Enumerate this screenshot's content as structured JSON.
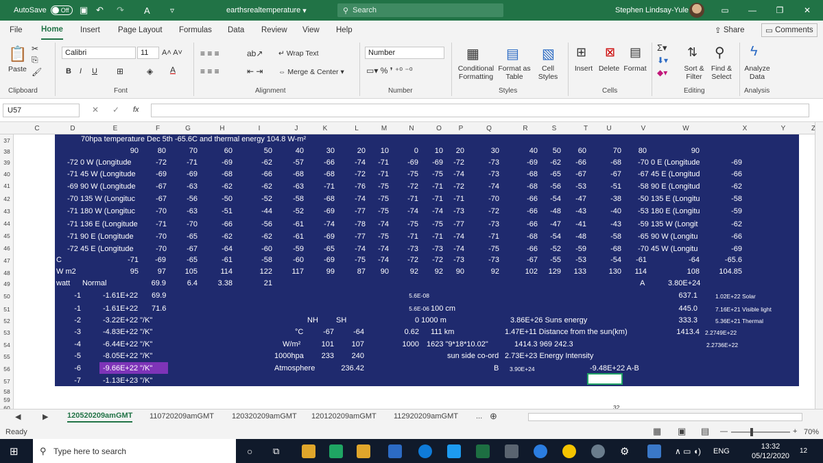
{
  "titlebar": {
    "autosave": "AutoSave",
    "autosave_state": "Off",
    "filename": "earthsrealtemperature",
    "search": "Search",
    "user": "Stephen Lindsay-Yule"
  },
  "menu": [
    "File",
    "Home",
    "Insert",
    "Page Layout",
    "Formulas",
    "Data",
    "Review",
    "View",
    "Help"
  ],
  "share": "Share",
  "comments": "Comments",
  "ribbon": {
    "paste": "Paste",
    "font_name": "Calibri",
    "font_size": "11",
    "wrap_text": "Wrap Text",
    "merge_center": "Merge & Center",
    "number_format": "Number",
    "conditional_formatting": "Conditional Formatting",
    "format_as_table": "Format as Table",
    "cell_styles": "Cell Styles",
    "insert": "Insert",
    "delete": "Delete",
    "format": "Format",
    "sort_filter": "Sort & Filter",
    "find_select": "Find & Select",
    "analyze_data": "Analyze Data",
    "groups": [
      "Clipboard",
      "Font",
      "Alignment",
      "Number",
      "Styles",
      "Cells",
      "Editing",
      "Analysis"
    ]
  },
  "namebox": "U57",
  "fx": "fx",
  "columns": [
    "C",
    "D",
    "E",
    "F",
    "G",
    "H",
    "I",
    "J",
    "K",
    "L",
    "M",
    "N",
    "O",
    "P",
    "Q",
    "R",
    "S",
    "T",
    "U",
    "V",
    "W",
    "X",
    "Y",
    "Z"
  ],
  "rows": [
    "37",
    "38",
    "39",
    "40",
    "41",
    "42",
    "43",
    "44",
    "45",
    "46",
    "47",
    "48",
    "49",
    "50",
    "51",
    "52",
    "53",
    "54",
    "55",
    "56",
    "57",
    "58",
    "59",
    "60"
  ],
  "title_line": "70hpa temperature Dec 5th  -65.6C and thermal energy 104.8 W-m²",
  "lat_header": [
    "90",
    "80",
    "70",
    "60",
    "50",
    "40",
    "30",
    "20",
    "10",
    "0",
    "10",
    "20",
    "30",
    "40",
    "50",
    "60",
    "70",
    "80",
    "90"
  ],
  "table_rows": [
    {
      "label": "-72 0 W (Longitude",
      "v": [
        "-72",
        "-71",
        "-69",
        "-62",
        "-57",
        "-66",
        "-74",
        "-71",
        "-69",
        "-69",
        "-72",
        "-73",
        "-69",
        "-62",
        "-66",
        "-68"
      ],
      "rlabel": "-70 0 E (Longitude",
      "end": "-69"
    },
    {
      "label": "-71 45 W (Longitude",
      "v": [
        "-69",
        "-69",
        "-68",
        "-66",
        "-68",
        "-68",
        "-72",
        "-71",
        "-75",
        "-75",
        "-74",
        "-73",
        "-68",
        "-65",
        "-67",
        "-67"
      ],
      "rlabel": "-67 45 E (Longitud",
      "end": "-66"
    },
    {
      "label": "-69 90 W (Longitude",
      "v": [
        "-67",
        "-63",
        "-62",
        "-62",
        "-63",
        "-71",
        "-76",
        "-75",
        "-72",
        "-71",
        "-72",
        "-74",
        "-68",
        "-56",
        "-53",
        "-51"
      ],
      "rlabel": "-58 90 E (Longitud",
      "end": "-62"
    },
    {
      "label": "-70 135 W (Longituc",
      "v": [
        "-67",
        "-56",
        "-50",
        "-52",
        "-58",
        "-68",
        "-74",
        "-75",
        "-71",
        "-71",
        "-71",
        "-70",
        "-66",
        "-54",
        "-47",
        "-38"
      ],
      "rlabel": "-50 135 E (Longitu",
      "end": "-58"
    },
    {
      "label": "-71 180 W (Longituc",
      "v": [
        "-70",
        "-63",
        "-51",
        "-44",
        "-52",
        "-69",
        "-77",
        "-75",
        "-74",
        "-74",
        "-73",
        "-72",
        "-66",
        "-48",
        "-43",
        "-40"
      ],
      "rlabel": "-53 180 E (Longitu",
      "end": "-59"
    },
    {
      "label": "-71 136 E (Longitude",
      "v": [
        "-71",
        "-70",
        "-66",
        "-56",
        "-61",
        "-74",
        "-78",
        "-74",
        "-75",
        "-75",
        "-77",
        "-73",
        "-66",
        "-47",
        "-41",
        "-43"
      ],
      "rlabel": "-59 135 W (Longit",
      "end": "-62"
    },
    {
      "label": "-71 90 E (Longitude",
      "v": [
        "-70",
        "-65",
        "-62",
        "-62",
        "-61",
        "-69",
        "-77",
        "-75",
        "-71",
        "-71",
        "-74",
        "-71",
        "-68",
        "-54",
        "-48",
        "-58"
      ],
      "rlabel": "-65 90 W (Longitu",
      "end": "-66"
    },
    {
      "label": "-72 45 E (Longitude",
      "v": [
        "-70",
        "-67",
        "-64",
        "-60",
        "-59",
        "-65",
        "-74",
        "-74",
        "-73",
        "-73",
        "-74",
        "-75",
        "-66",
        "-52",
        "-59",
        "-68"
      ],
      "rlabel": "-70 45 W (Longitu",
      "end": "-69"
    }
  ],
  "row_c": {
    "label": "C",
    "v": [
      "-71",
      "-69",
      "-65",
      "-61",
      "-58",
      "-60",
      "-69",
      "-75",
      "-74",
      "-72",
      "-72",
      "-73",
      "-73",
      "-67",
      "-55",
      "-53",
      "-54",
      "-61",
      "-64",
      "-65.6"
    ]
  },
  "row_w": {
    "label": "W m2",
    "v": [
      "95",
      "97",
      "105",
      "114",
      "122",
      "117",
      "99",
      "87",
      "90",
      "92",
      "92",
      "90",
      "92",
      "102",
      "129",
      "133",
      "130",
      "114",
      "108",
      "104.85"
    ]
  },
  "row49": {
    "watt": "watt",
    "normal": "Normal",
    "a": "69.9",
    "b": "6.4",
    "c": "3.38",
    "d": "21",
    "A": "A",
    "val": "3.80E+24"
  },
  "lower": {
    "d": [
      "-1",
      "-1",
      "-2",
      "-3",
      "-4",
      "-5",
      "-6",
      "-7"
    ],
    "e": [
      "-1.61E+22",
      "-1.61E+22",
      "-3.22E+22  \"/K\"",
      "-4.83E+22  \"/K\"",
      "-6.44E+22  \"/K\"",
      "-8.05E+22  \"/K\"",
      "-9.66E+22  \"/K\"",
      "-1.13E+23  \"/K\""
    ],
    "f50": "69.9",
    "f51": "71.6",
    "nh": "NH",
    "sh": "SH",
    "degc": "°C",
    "degc_nh": "-67",
    "degc_sh": "-64",
    "wm2": "W/m²",
    "wm2_nh": "101",
    "wm2_sh": "107",
    "hpa": "1000hpa",
    "hpa_nh": "233",
    "hpa_sh": "240",
    "atm": "Atmosphere",
    "atm_val": "236.42",
    "n50": "5.6E-08",
    "n51": "5.6E-06",
    "o51": "100  cm",
    "o52": "0  1000  m",
    "n53": "0.62",
    "o53": "111  km",
    "n54": "1000",
    "o54": "1623  \"9*18*10.02\"",
    "p55": "sun side co-ord",
    "r55": "2.73E+23  Energy Intensity",
    "q56": "B",
    "r56": "3.90E+24",
    "r52": "3.86E+26  Suns energy",
    "r53": "1.47E+11  Distance from the sun(km)",
    "r54": "1414.3   969  242.3",
    "u56": "-9.48E+22  A-B",
    "w50": "637.1",
    "w51": "445.0",
    "w52": "333.3",
    "w53": "1413.4",
    "x50": "1.02E+22  Solar",
    "x51": "7.16E+21  Visible light",
    "x52": "5.36E+21  Thermal",
    "x53": "2.2749E+22",
    "x54": "2.2736E+22",
    "u60": "32"
  },
  "sheets": [
    "120520209amGMT",
    "110720209amGMT",
    "120320209amGMT",
    "120120209amGMT",
    "112920209amGMT",
    "..."
  ],
  "status": {
    "ready": "Ready",
    "zoom": "70%"
  },
  "taskbar": {
    "search": "Type here to search",
    "lang": "ENG",
    "time": "13:32",
    "date": "05/12/2020",
    "notif": "12"
  },
  "colors": {
    "excel_green": "#217346",
    "cell_navy": "#1f2a6e",
    "highlight_purple": "#7e34b8"
  }
}
